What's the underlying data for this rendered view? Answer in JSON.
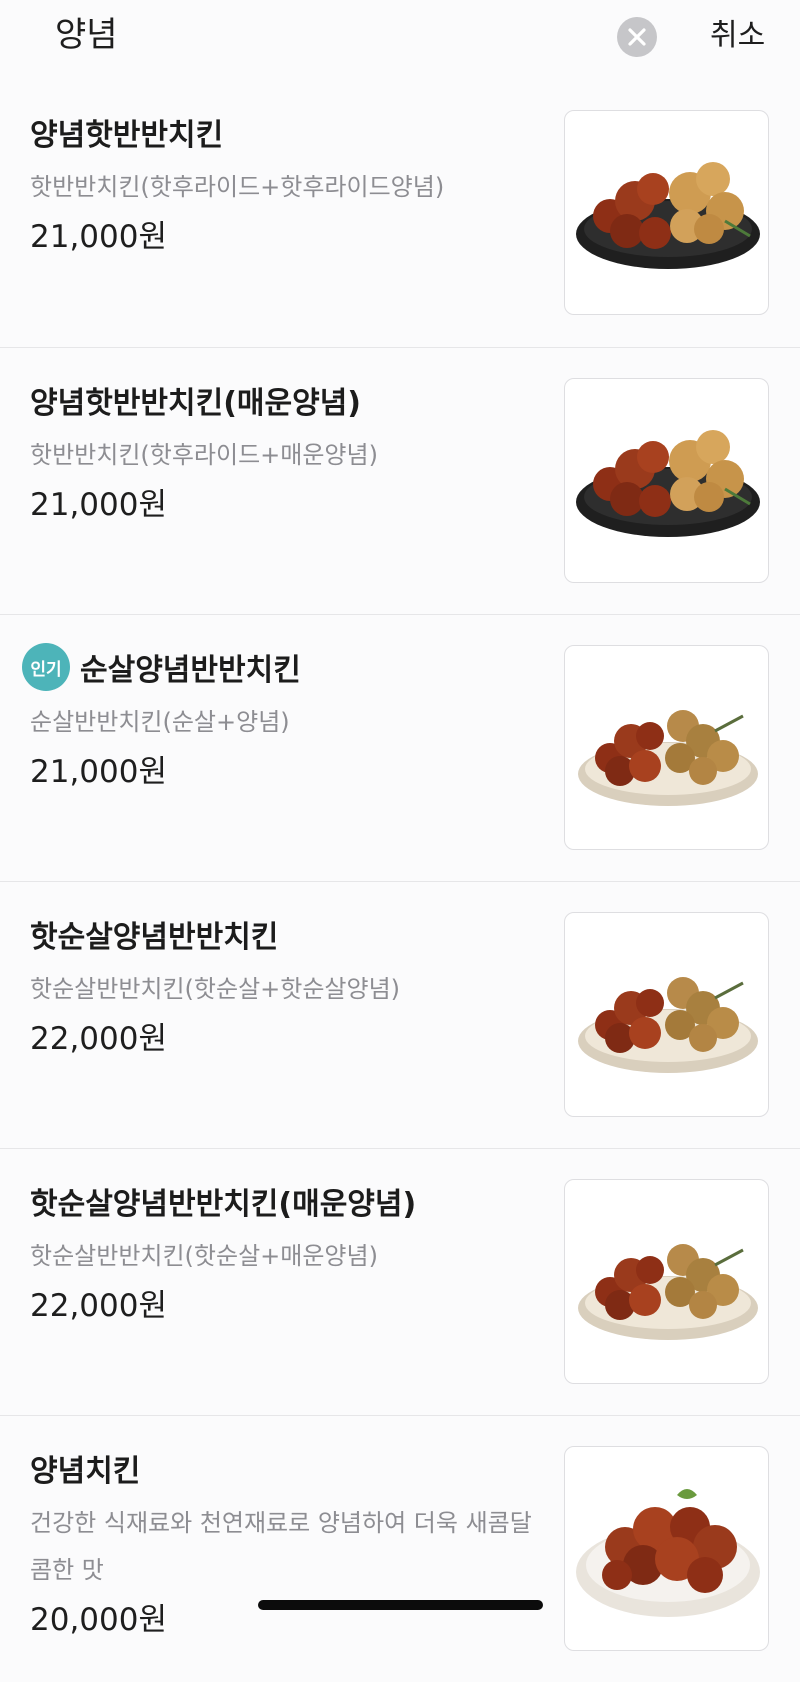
{
  "search": {
    "query": "양념",
    "cancel_label": "취소",
    "clear_icon": "close-circle-icon"
  },
  "menu": [
    {
      "name": "양념핫반반치킨",
      "description": "핫반반치킨(핫후라이드+핫후라이드양념)",
      "price": "21,000원",
      "badge": "",
      "image": "half-half-chicken-dark-plate"
    },
    {
      "name": "양념핫반반치킨(매운양념)",
      "description": "핫반반치킨(핫후라이드+매운양념)",
      "price": "21,000원",
      "badge": "",
      "image": "half-half-chicken-dark-plate"
    },
    {
      "name": "순살양념반반치킨",
      "description": "순살반반치킨(순살+양념)",
      "price": "21,000원",
      "badge": "인기",
      "image": "boneless-half-half-chicken-plate"
    },
    {
      "name": "핫순살양념반반치킨",
      "description": "핫순살반반치킨(핫순살+핫순살양념)",
      "price": "22,000원",
      "badge": "",
      "image": "boneless-half-half-chicken-plate"
    },
    {
      "name": "핫순살양념반반치킨(매운양념)",
      "description": "핫순살반반치킨(핫순살+매운양념)",
      "price": "22,000원",
      "badge": "",
      "image": "boneless-half-half-chicken-plate"
    },
    {
      "name": "양념치킨",
      "description": "건강한 식재료와 천연재료로 양념하여 더욱 새콤달콤한 맛",
      "price": "20,000원",
      "badge": "",
      "image": "seasoned-chicken-plate"
    }
  ],
  "colors": {
    "badge": "#4db4b9",
    "sauce": "#9a3a1c",
    "fried": "#c7944a",
    "dark_plate": "#1f1f1f",
    "light_plate": "#efe7d8"
  }
}
